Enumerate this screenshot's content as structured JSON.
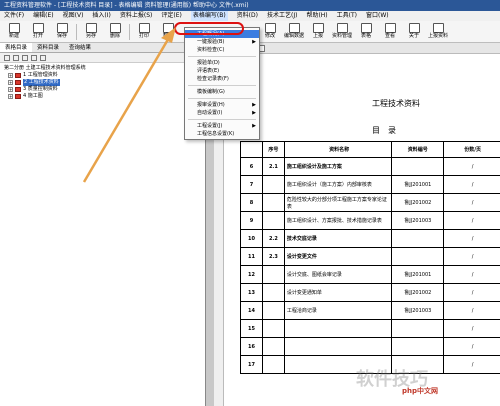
{
  "window": {
    "title": "工程资料管理软件 - [工程技术资料 目录] - 表格编辑 资料管理(通用版) 帮助中心 文件(.xmi)"
  },
  "menubar": [
    "文件(F)",
    "编辑(E)",
    "视图(V)",
    "插入(I)",
    "资料上报(S)",
    "评定(E)",
    "表格编写(B)",
    "资料(D)",
    "技术工艺(J)",
    "帮助(H)",
    "工具(T)",
    "窗口(W)"
  ],
  "toolbar": {
    "buttons": [
      "新建",
      "打开",
      "保存",
      "另存",
      "删除",
      "打印",
      "帮助"
    ],
    "right_buttons": [
      "修改",
      "编辑数据",
      "上报",
      "资料管理",
      "表格",
      "查看",
      "关于",
      "上报资料"
    ]
  },
  "left_panel": {
    "tabs": [
      "表格目录",
      "资料目录",
      "查询结果"
    ],
    "tree": [
      {
        "label": "第二分册  土建工程技术资料管理系统",
        "level": 0,
        "selected": false
      },
      {
        "label": "1 工程管理资料",
        "level": 1,
        "selected": false
      },
      {
        "label": "2 工程技术资料",
        "level": 1,
        "selected": true
      },
      {
        "label": "3 质量控制资料",
        "level": 1,
        "selected": false
      },
      {
        "label": "4 施工图",
        "level": 1,
        "selected": false
      }
    ]
  },
  "dropdown": {
    "items": [
      {
        "label": "工程概况(A)",
        "highlight": true,
        "submenu": false
      },
      {
        "label": "一键报验(B)",
        "highlight": false,
        "submenu": true
      },
      {
        "label": "资料检查(C)",
        "highlight": false,
        "submenu": false
      },
      {
        "sep": true
      },
      {
        "label": "报验单(D)",
        "highlight": false,
        "submenu": false
      },
      {
        "label": "评语表(E)",
        "highlight": false,
        "submenu": false
      },
      {
        "label": "检查记录表(F)",
        "highlight": false,
        "submenu": false
      },
      {
        "sep": true
      },
      {
        "label": "模板编制(G)",
        "highlight": false,
        "submenu": false
      },
      {
        "sep": true
      },
      {
        "label": "报审设置(H)",
        "highlight": false,
        "submenu": true
      },
      {
        "label": "自动设置(I)",
        "highlight": false,
        "submenu": true
      },
      {
        "sep": true
      },
      {
        "label": "工程设置(J)",
        "highlight": false,
        "submenu": true
      },
      {
        "label": "工程信息设置(K)",
        "highlight": false,
        "submenu": false
      }
    ]
  },
  "document": {
    "title": "工程技术资料",
    "subtitle": "目录",
    "headers": [
      "序号",
      "资料名称",
      "资料编号",
      "份数/页"
    ],
    "rows": [
      {
        "no": "6",
        "seq": "2.1",
        "name": "施工组织设计及施工方案",
        "code": "",
        "pages": "/",
        "bold": true
      },
      {
        "no": "7",
        "seq": "",
        "name": "施工组织设计（施工方案）内部审核表",
        "code": "鲁JJ201001",
        "pages": "/",
        "bold": false
      },
      {
        "no": "8",
        "seq": "",
        "name": "危险性较大的分部分项工程施工方案专家论证表",
        "code": "鲁JJ201002",
        "pages": "/",
        "bold": false
      },
      {
        "no": "9",
        "seq": "",
        "name": "施工组织设计、方案报批、技术措施记录表",
        "code": "鲁JJ201003",
        "pages": "/",
        "bold": false
      },
      {
        "no": "10",
        "seq": "2.2",
        "name": "技术交底记录",
        "code": "",
        "pages": "/",
        "bold": true
      },
      {
        "no": "11",
        "seq": "2.3",
        "name": "设计变更文件",
        "code": "",
        "pages": "/",
        "bold": true
      },
      {
        "no": "12",
        "seq": "",
        "name": "设计交底、图纸会审记录",
        "code": "鲁JJ201001",
        "pages": "/",
        "bold": false
      },
      {
        "no": "13",
        "seq": "",
        "name": "设计变更通知单",
        "code": "鲁JJ201002",
        "pages": "/",
        "bold": false
      },
      {
        "no": "14",
        "seq": "",
        "name": "工程洽商记录",
        "code": "鲁JJ201003",
        "pages": "/",
        "bold": false
      },
      {
        "no": "15",
        "seq": "",
        "name": "",
        "code": "",
        "pages": "/",
        "bold": false
      },
      {
        "no": "16",
        "seq": "",
        "name": "",
        "code": "",
        "pages": "/",
        "bold": false
      },
      {
        "no": "17",
        "seq": "",
        "name": "",
        "code": "",
        "pages": "/",
        "bold": false
      }
    ]
  },
  "watermark": {
    "text": "软件技巧",
    "logo": "php中文网"
  },
  "colors": {
    "highlight": "#3c7de0",
    "annotation_red": "#d11111",
    "annotation_arrow": "#e8a34a"
  }
}
